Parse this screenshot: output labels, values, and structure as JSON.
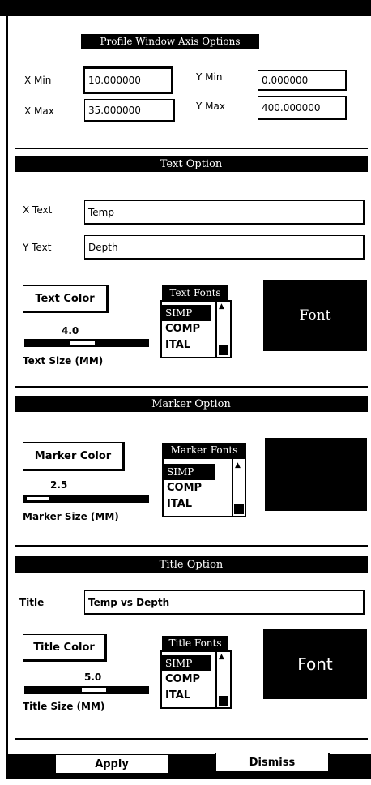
{
  "profile_axis": {
    "title": "Profile Window Axis Options",
    "x_min_label": "X Min",
    "x_min_value": "10.000000",
    "x_max_label": "X Max",
    "x_max_value": "35.000000",
    "y_min_label": "Y Min",
    "y_min_value": "0.000000",
    "y_max_label": "Y Max",
    "y_max_value": "400.000000"
  },
  "text_option": {
    "title": "Text Option",
    "x_text_label": "X Text",
    "x_text_value": "Temp",
    "y_text_label": "Y Text",
    "y_text_value": "Depth",
    "color_button": "Text Color",
    "size_value": "4.0",
    "size_label": "Text Size (MM)",
    "fonts_title": "Text Fonts",
    "fonts": [
      "SIMP",
      "COMP",
      "ITAL"
    ],
    "preview": "Font"
  },
  "marker_option": {
    "title": "Marker Option",
    "color_button": "Marker Color",
    "size_value": "2.5",
    "size_label": "Marker Size (MM)",
    "fonts_title": "Marker Fonts",
    "fonts": [
      "SIMP",
      "COMP",
      "ITAL"
    ]
  },
  "title_option": {
    "title": "Title Option",
    "title_label": "Title",
    "title_value": "Temp vs Depth",
    "color_button": "Title Color",
    "size_value": "5.0",
    "size_label": "Title Size (MM)",
    "fonts_title": "Title Fonts",
    "fonts": [
      "SIMP",
      "COMP",
      "ITAL"
    ],
    "preview": "Font"
  },
  "actions": {
    "apply": "Apply",
    "dismiss": "Dismiss"
  },
  "icons": {
    "scroll_up": "scroll-up-arrow",
    "scroll_down": "scroll-down-arrow"
  }
}
